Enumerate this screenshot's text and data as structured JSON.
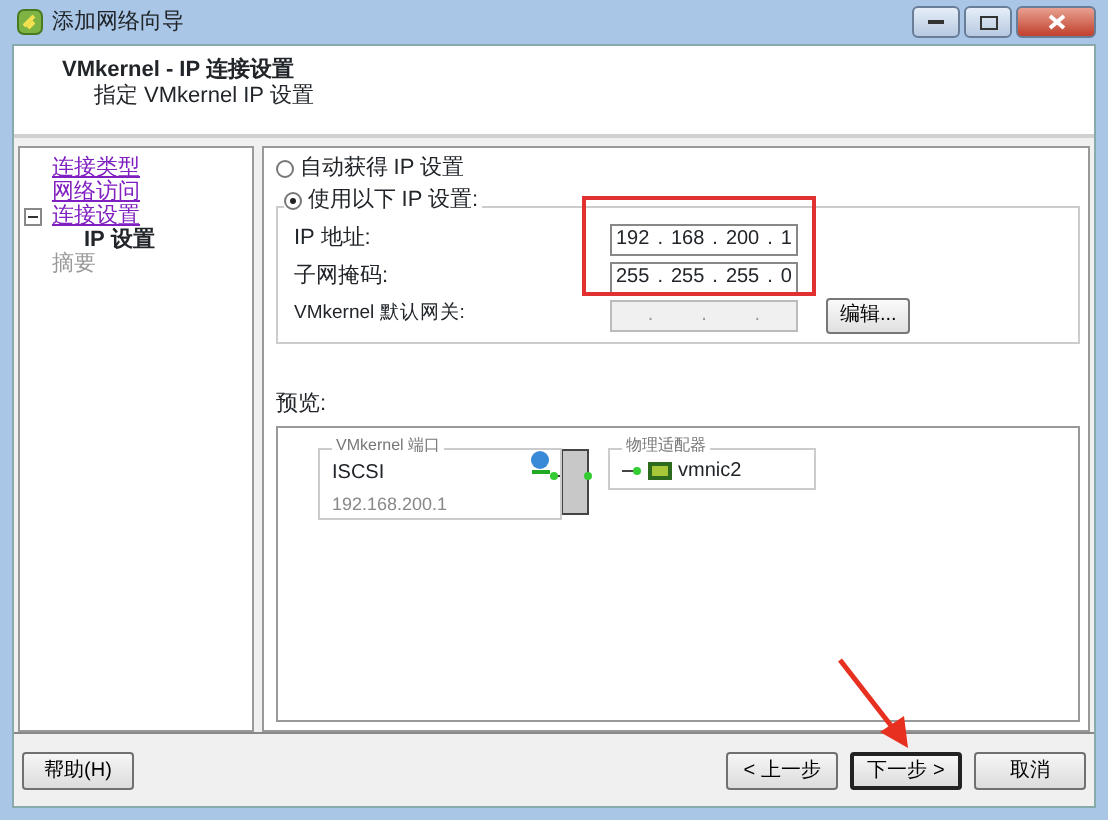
{
  "window": {
    "title": "添加网络向导"
  },
  "header": {
    "title": "VMkernel - IP 连接设置",
    "subtitle": "指定 VMkernel IP 设置"
  },
  "nav": [
    {
      "label": "连接类型",
      "kind": "link"
    },
    {
      "label": "网络访问",
      "kind": "link"
    },
    {
      "label": "连接设置",
      "kind": "link",
      "expanded": true,
      "children": [
        {
          "label": "IP 设置",
          "kind": "current"
        }
      ]
    },
    {
      "label": "摘要",
      "kind": "disabled"
    }
  ],
  "ip_mode": [
    {
      "label": "自动获得 IP 设置",
      "selected": false
    },
    {
      "label": "使用以下 IP 设置:",
      "selected": true
    }
  ],
  "fields": [
    {
      "label": "IP 地址:",
      "octets": [
        "192",
        "168",
        "200",
        "1"
      ],
      "separator": ".",
      "disabled": false
    },
    {
      "label": "子网掩码:",
      "octets": [
        "255",
        "255",
        "255",
        "0"
      ],
      "separator": ".",
      "disabled": false
    },
    {
      "label": "VMkernel 默认网关:",
      "separator": ".",
      "disabled": true
    }
  ],
  "edit_button": "编辑...",
  "preview": {
    "label": "预览:",
    "port_legend": "VMkernel 端口",
    "port_name": "ISCSI",
    "port_ip": "192.168.200.1",
    "adapter_legend": "物理适配器",
    "adapter_name": "vmnic2"
  },
  "buttons": [
    {
      "label": "帮助(H)",
      "default": false
    },
    {
      "label": "< 上一步",
      "default": false
    },
    {
      "label": "下一步 >",
      "default": true
    },
    {
      "label": "取消",
      "default": false
    }
  ]
}
